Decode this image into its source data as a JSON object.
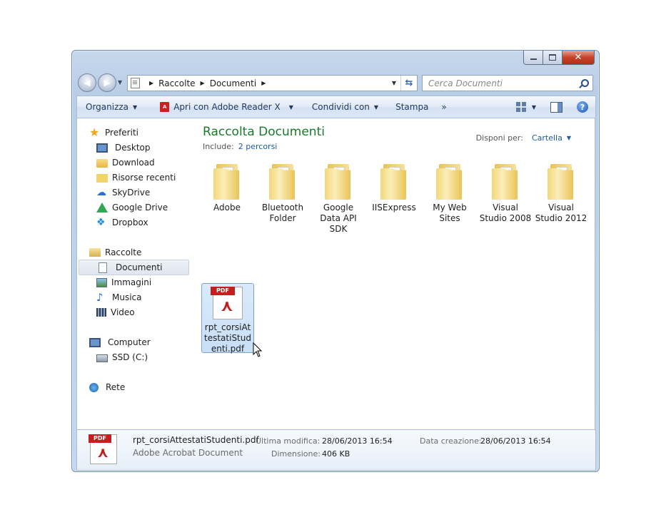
{
  "window": {
    "caption_buttons": {
      "minimize": "",
      "maximize": "",
      "close": "✕"
    }
  },
  "address": {
    "crumbs": [
      "Raccolte",
      "Documenti"
    ]
  },
  "search": {
    "placeholder": "Cerca Documenti"
  },
  "toolbar": {
    "organize": "Organizza",
    "open_with": "Apri con Adobe Reader X",
    "share": "Condividi con",
    "print": "Stampa",
    "more": "»"
  },
  "sidebar": {
    "favorites": "Preferiti",
    "favorite_items": [
      "Desktop",
      "Download",
      "Risorse recenti",
      "SkyDrive",
      "Google Drive",
      "Dropbox"
    ],
    "libraries": "Raccolte",
    "library_items": [
      "Documenti",
      "Immagini",
      "Musica",
      "Video"
    ],
    "computer": "Computer",
    "computer_items": [
      "SSD (C:)"
    ],
    "network": "Rete"
  },
  "library": {
    "title": "Raccolta Documenti",
    "include_label": "Include:",
    "include_link": "2 percorsi",
    "arrange_label": "Disponi per:",
    "arrange_value": "Cartella"
  },
  "items": [
    {
      "name": "Adobe"
    },
    {
      "name": "Bluetooth Folder"
    },
    {
      "name": "Google Data API SDK"
    },
    {
      "name": "IISExpress"
    },
    {
      "name": "My Web Sites"
    },
    {
      "name": "Visual Studio 2008"
    },
    {
      "name": "Visual Studio 2012"
    }
  ],
  "selected_file": {
    "tile_label": "rpt_corsiAttestatiStudenti.pdf",
    "tag": "PDF"
  },
  "details": {
    "name": "rpt_corsiAttestatiStudenti.pdf",
    "type": "Adobe Acrobat Document",
    "modified_label": "Ultima modifica:",
    "modified_value": "28/06/2013 16:54",
    "size_label": "Dimensione:",
    "size_value": "406 KB",
    "created_label": "Data creazione:",
    "created_value": "28/06/2013 16:54"
  },
  "colors": {
    "library_title": "#1b7a2a",
    "link": "#1c5aa9",
    "selection": "#c8dff6",
    "pdf_red": "#c31f1f"
  }
}
